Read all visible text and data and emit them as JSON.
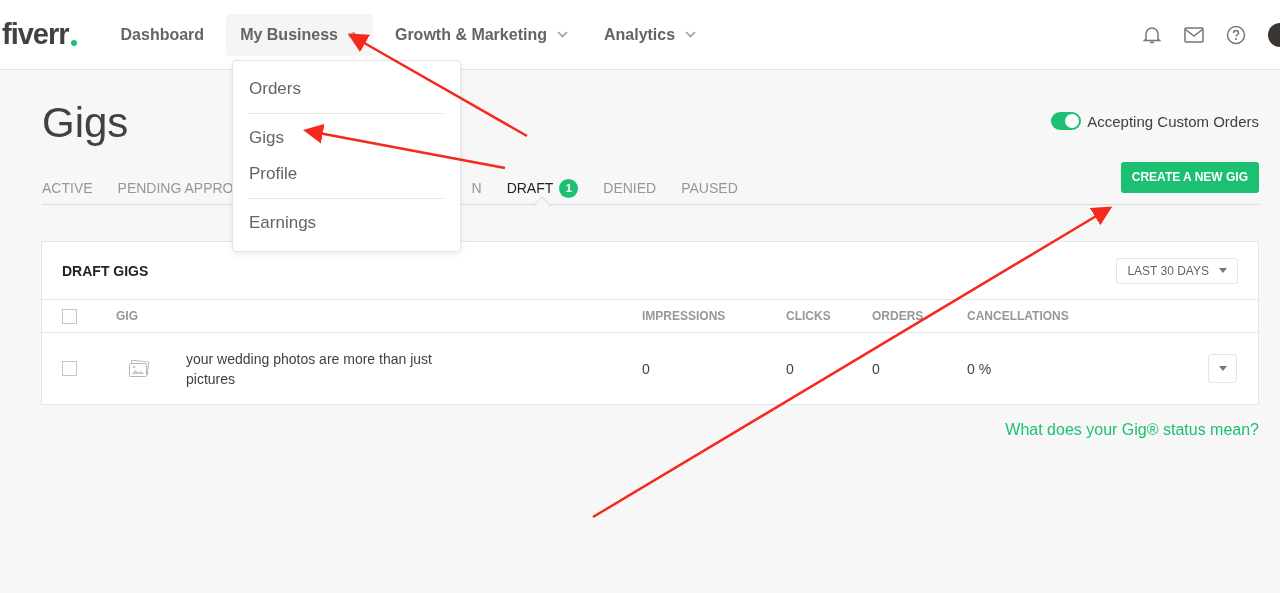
{
  "header": {
    "logo": "fiverr",
    "nav": [
      {
        "label": "Dashboard",
        "selected": false,
        "has_caret": false
      },
      {
        "label": "My Business",
        "selected": true,
        "has_caret": true
      },
      {
        "label": "Growth & Marketing",
        "selected": false,
        "has_caret": true
      },
      {
        "label": "Analytics",
        "selected": false,
        "has_caret": true
      }
    ]
  },
  "menu": {
    "groups": [
      [
        "Orders"
      ],
      [
        "Gigs",
        "Profile"
      ],
      [
        "Earnings"
      ]
    ]
  },
  "page": {
    "title": "Gigs",
    "custom_orders": {
      "label": "Accepting Custom Orders",
      "on": true
    },
    "tabs": [
      {
        "label": "ACTIVE",
        "selected": false
      },
      {
        "label": "PENDING APPRO",
        "selected": false
      },
      {
        "label": "N",
        "selected": false
      },
      {
        "label": "DRAFT",
        "selected": true,
        "count": "1"
      },
      {
        "label": "DENIED",
        "selected": false
      },
      {
        "label": "PAUSED",
        "selected": false
      }
    ],
    "create_button": "CREATE A NEW GIG"
  },
  "table": {
    "title": "DRAFT GIGS",
    "period": "LAST 30 DAYS",
    "select_all": {
      "checked": false
    },
    "columns": [
      "GIG",
      "IMPRESSIONS",
      "CLICKS",
      "ORDERS",
      "CANCELLATIONS"
    ],
    "rows": [
      {
        "checked": false,
        "title": "your wedding photos are more than just pictures",
        "impressions": "0",
        "clicks": "0",
        "orders": "0",
        "cancellations": "0 %"
      }
    ]
  },
  "help_link": "What does your Gig® status mean?"
}
